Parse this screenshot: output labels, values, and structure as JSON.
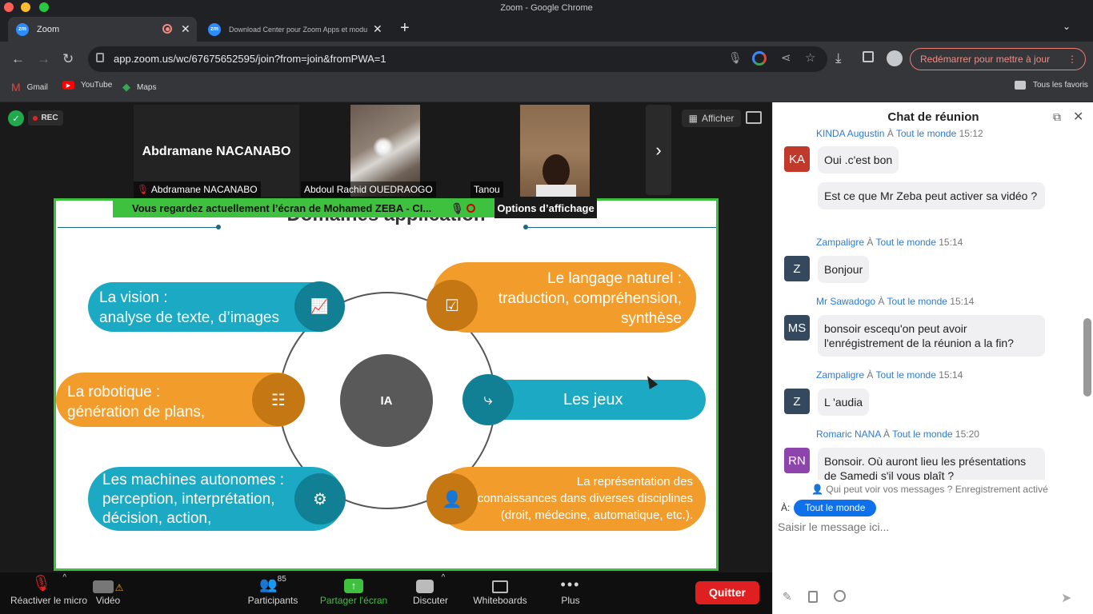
{
  "window": {
    "title": "Zoom - Google Chrome"
  },
  "tabs": [
    {
      "label": "Zoom"
    },
    {
      "label": "Download Center pour Zoom Apps et modu"
    }
  ],
  "url": "app.zoom.us/wc/67675652595/join?from=join&fromPWA=1",
  "relaunch_label": "Redémarrer pour mettre à jour",
  "bookmarks": [
    "Gmail",
    "YouTube",
    "Maps"
  ],
  "all_bookmarks_label": "Tous les favoris",
  "meeting": {
    "rec_label": "REC",
    "view_button": "Afficher",
    "participants": [
      {
        "name": "Abdramane NACANABO",
        "display": "Abdramane NACANABO"
      },
      {
        "name": "Abdoul Rachid OUEDRAOGO"
      },
      {
        "name": "Tanou"
      }
    ],
    "share_banner": "Vous regardez actuellement l’écran de  Mohamed ZEBA - CI...",
    "view_options": "Options d’affichage"
  },
  "slide": {
    "title": "Domaines application",
    "center": "IA",
    "items": [
      {
        "text": "La vision :\nanalyse de texte, d’images",
        "color": "#1ba9c4",
        "icon": "chart-icon"
      },
      {
        "text": "Le langage naturel :\ntraduction, compréhension,\nsynthèse",
        "color": "#f29d2b",
        "icon": "checklist-icon"
      },
      {
        "text": "La robotique :\ngénération de plans,",
        "color": "#f29d2b",
        "icon": "sliders-icon"
      },
      {
        "text": "Les jeux",
        "color": "#1ba9c4",
        "icon": "share-nodes-icon"
      },
      {
        "text": "Les machines autonomes :\nperception, interprétation,\ndécision, action,",
        "color": "#1ba9c4",
        "icon": "gears-icon"
      },
      {
        "text": "La représentation des\nconnaissances dans diverses disciplines\n(droit, médecine, automatique, etc.).",
        "color": "#f29d2b",
        "icon": "person-gear-icon"
      }
    ]
  },
  "toolbar": {
    "mic": "Réactiver le micro",
    "video": "Vidéo",
    "participants": "Participants",
    "participants_count": "85",
    "share": "Partager l'écran",
    "chat": "Discuter",
    "whiteboards": "Whiteboards",
    "more": "Plus",
    "leave": "Quitter"
  },
  "chat": {
    "title": "Chat de réunion",
    "to_label": "À",
    "messages": [
      {
        "sender": "KINDA Augustin",
        "to": "Tout le monde",
        "time": "15:12",
        "avatar": "KA",
        "avatar_color": "#c0392b",
        "lines": [
          "Oui .c'est bon"
        ]
      },
      {
        "continuation": true,
        "lines": [
          "Est ce que Mr Zeba peut activer sa vidéo ?"
        ]
      },
      {
        "sender": "Zampaligre",
        "to": "Tout le monde",
        "time": "15:14",
        "avatar": "Z",
        "avatar_color": "#34495e",
        "lines": [
          "Bonjour"
        ]
      },
      {
        "sender": "Mr Sawadogo",
        "to": "Tout le monde",
        "time": "15:14",
        "avatar": "MS",
        "avatar_color": "#34495e",
        "lines": [
          "bonsoir escequ'on peut avoir l'enrégistrement de la réunion a la fin?"
        ]
      },
      {
        "sender": "Zampaligre",
        "to": "Tout le monde",
        "time": "15:14",
        "avatar": "Z",
        "avatar_color": "#34495e",
        "lines": [
          "L 'audia"
        ]
      },
      {
        "sender": "Romaric NANA",
        "to": "Tout le monde",
        "time": "15:20",
        "avatar": "RN",
        "avatar_color": "#8e44ad",
        "lines": [
          "Bonsoir. Où auront lieu les présentations de Samedi s'il vous plaît ?"
        ]
      }
    ],
    "visibility_note": "Qui peut voir vos messages ? Enregistrement activé",
    "recipient_label": "À:",
    "recipient": "Tout le monde",
    "input_placeholder": "Saisir le message ici..."
  }
}
